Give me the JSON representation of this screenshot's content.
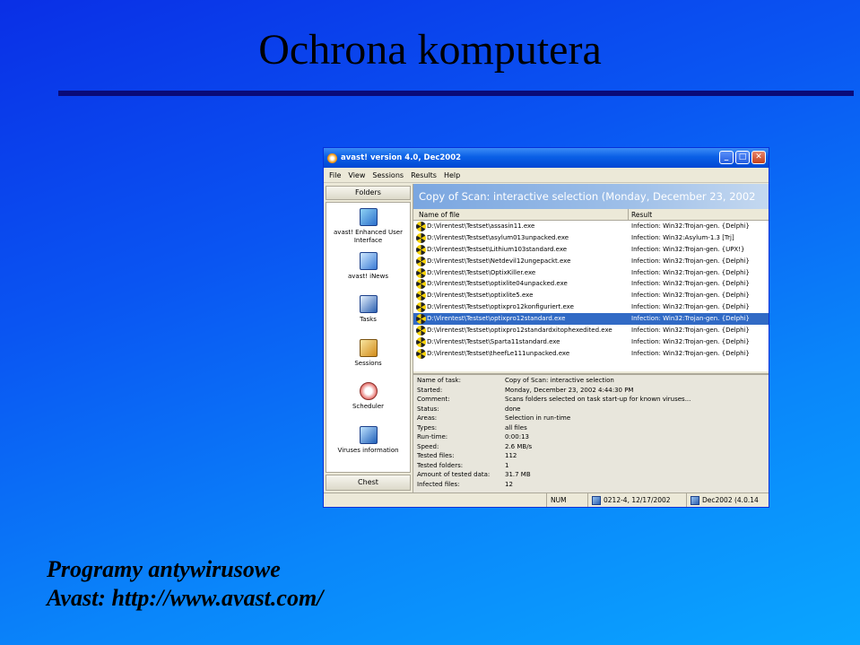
{
  "slide": {
    "title": "Ochrona komputera",
    "caption_line1": "Programy antywirusowe",
    "caption_line2": "Avast: http://www.avast.com/"
  },
  "window": {
    "title": "avast! version 4.0, Dec2002",
    "menu": [
      "File",
      "View",
      "Sessions",
      "Results",
      "Help"
    ],
    "sidebar": {
      "header": "Folders",
      "items": [
        {
          "label": "avast! Enhanced User Interface",
          "icon": "enhanced-ui-icon"
        },
        {
          "label": "avast! iNews",
          "icon": "inews-icon"
        },
        {
          "label": "Tasks",
          "icon": "tasks-icon"
        },
        {
          "label": "Sessions",
          "icon": "sessions-icon"
        },
        {
          "label": "Scheduler",
          "icon": "scheduler-icon"
        },
        {
          "label": "Viruses information",
          "icon": "viruses-info-icon"
        }
      ],
      "footer": "Chest"
    },
    "scan_header": "Copy of Scan: interactive selection (Monday, December 23, 2002",
    "table": {
      "col_file": "Name of file",
      "col_result": "Result",
      "rows": [
        {
          "file": "D:\\Virentest\\Testset\\assasin11.exe",
          "result": "Infection: Win32:Trojan-gen. {Delphi}"
        },
        {
          "file": "D:\\Virentest\\Testset\\asylum013unpacked.exe",
          "result": "Infection: Win32:Asylum-1.3 [Trj]"
        },
        {
          "file": "D:\\Virentest\\Testset\\Lithium103standard.exe",
          "result": "Infection: Win32:Trojan-gen. {UPX!}"
        },
        {
          "file": "D:\\Virentest\\Testset\\Netdevil12ungepackt.exe",
          "result": "Infection: Win32:Trojan-gen. {Delphi}"
        },
        {
          "file": "D:\\Virentest\\Testset\\OptixKiller.exe",
          "result": "Infection: Win32:Trojan-gen. {Delphi}"
        },
        {
          "file": "D:\\Virentest\\Testset\\optixlite04unpacked.exe",
          "result": "Infection: Win32:Trojan-gen. {Delphi}"
        },
        {
          "file": "D:\\Virentest\\Testset\\optixlite5.exe",
          "result": "Infection: Win32:Trojan-gen. {Delphi}"
        },
        {
          "file": "D:\\Virentest\\Testset\\optixpro12konfiguriert.exe",
          "result": "Infection: Win32:Trojan-gen. {Delphi}"
        },
        {
          "file": "D:\\Virentest\\Testset\\optixpro12standard.exe",
          "result": "Infection: Win32:Trojan-gen. {Delphi}",
          "selected": true
        },
        {
          "file": "D:\\Virentest\\Testset\\optixpro12standardxitophexedited.exe",
          "result": "Infection: Win32:Trojan-gen. {Delphi}"
        },
        {
          "file": "D:\\Virentest\\Testset\\Sparta11standard.exe",
          "result": "Infection: Win32:Trojan-gen. {Delphi}"
        },
        {
          "file": "D:\\Virentest\\Testset\\theefLe111unpacked.exe",
          "result": "Infection: Win32:Trojan-gen. {Delphi}"
        }
      ]
    },
    "details": [
      {
        "key": "Name of task:",
        "value": "Copy of Scan: interactive selection"
      },
      {
        "key": "Started:",
        "value": "Monday, December 23, 2002 4:44:30 PM"
      },
      {
        "key": "Comment:",
        "value": "Scans folders selected on task start-up for known viruses..."
      },
      {
        "key": "Status:",
        "value": "done"
      },
      {
        "key": "Areas:",
        "value": "Selection in run-time"
      },
      {
        "key": "Types:",
        "value": "all files"
      },
      {
        "key": "Run-time:",
        "value": "0:00:13"
      },
      {
        "key": "Speed:",
        "value": "2.6 MB/s"
      },
      {
        "key": "Tested files:",
        "value": "112"
      },
      {
        "key": "Tested folders:",
        "value": "1"
      },
      {
        "key": "Amount of tested data:",
        "value": "31.7 MB"
      },
      {
        "key": "Infected files:",
        "value": "12"
      }
    ],
    "statusbar": {
      "num": "NUM",
      "vps": "0212-4, 12/17/2002",
      "version": "Dec2002 (4.0.14"
    }
  }
}
